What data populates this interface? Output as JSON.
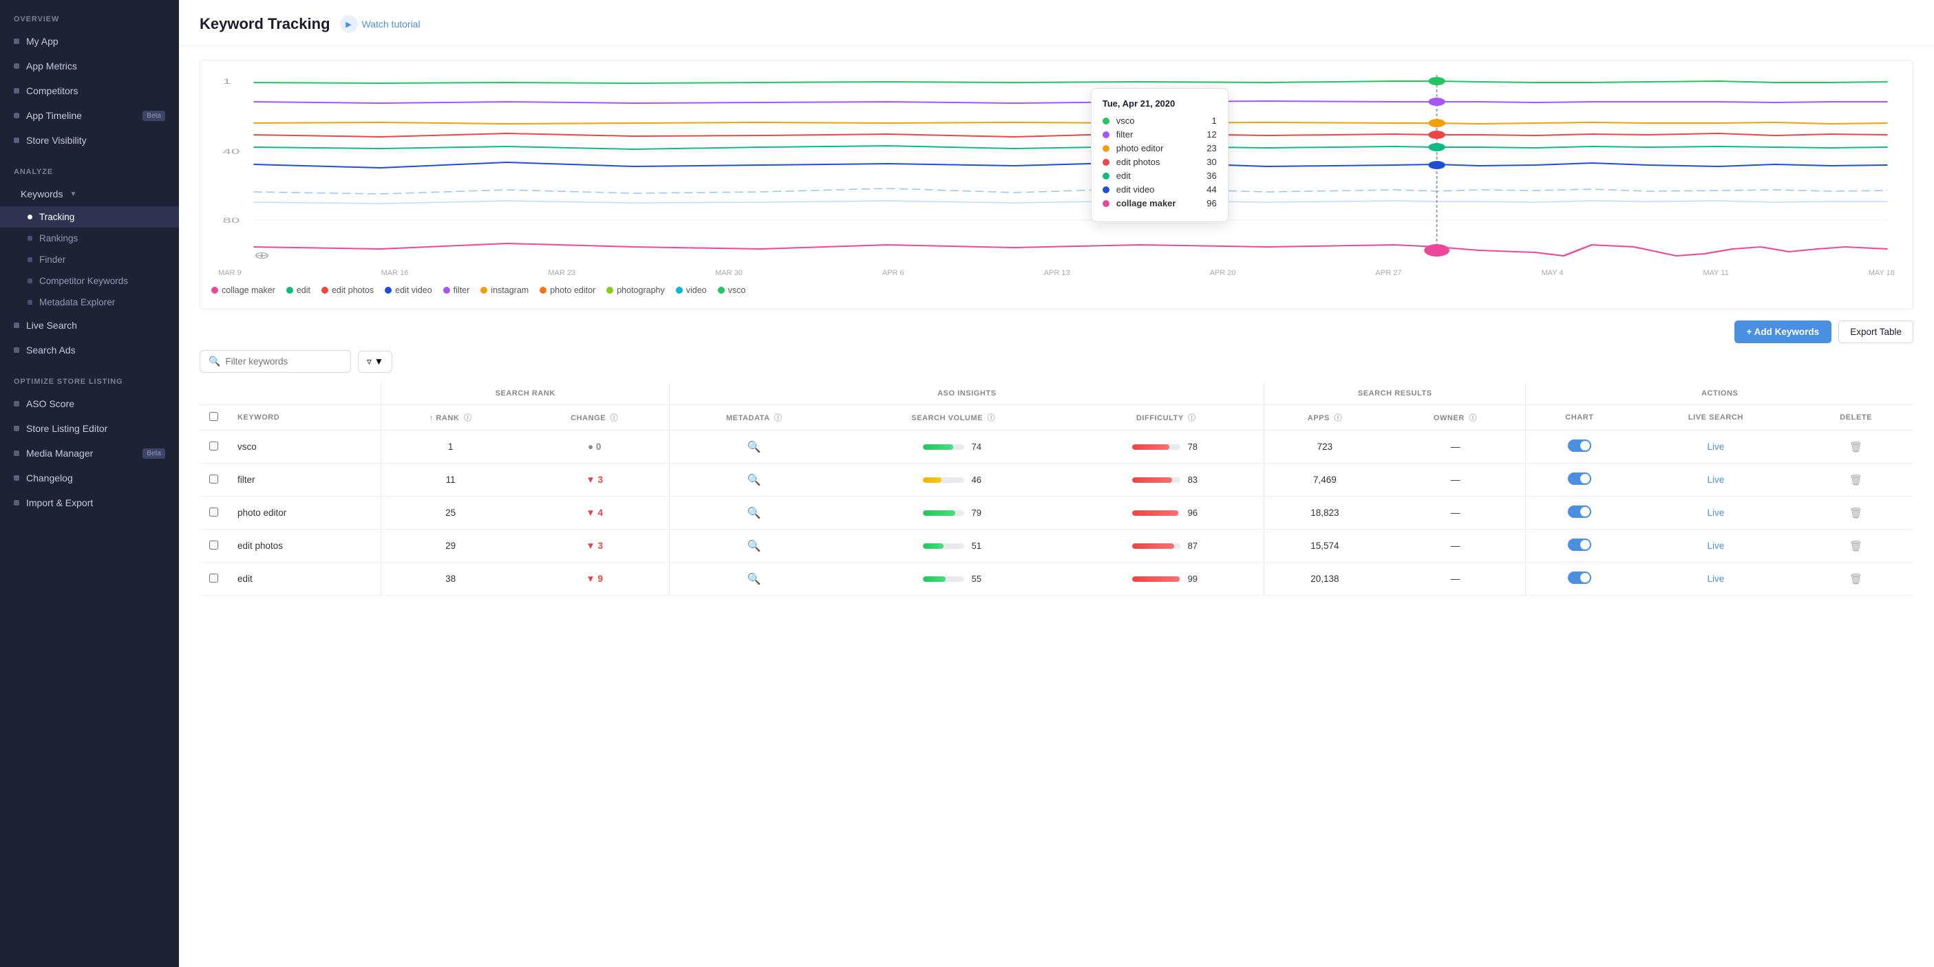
{
  "sidebar": {
    "overview_label": "OVERVIEW",
    "analyze_label": "ANALYZE",
    "optimize_label": "OPTIMIZE STORE LISTING",
    "items_overview": [
      {
        "label": "My App",
        "name": "my-app"
      },
      {
        "label": "App Metrics",
        "name": "app-metrics"
      },
      {
        "label": "Competitors",
        "name": "competitors"
      },
      {
        "label": "App Timeline",
        "name": "app-timeline",
        "badge": "Beta"
      },
      {
        "label": "Store Visibility",
        "name": "store-visibility"
      }
    ],
    "keywords_label": "Keywords",
    "keywords_sub": [
      {
        "label": "Tracking",
        "name": "tracking",
        "active": true
      },
      {
        "label": "Rankings",
        "name": "rankings"
      },
      {
        "label": "Finder",
        "name": "finder"
      },
      {
        "label": "Competitor Keywords",
        "name": "competitor-keywords"
      },
      {
        "label": "Metadata Explorer",
        "name": "metadata-explorer"
      }
    ],
    "items_other_analyze": [
      {
        "label": "Live Search",
        "name": "live-search"
      },
      {
        "label": "Search Ads",
        "name": "search-ads"
      }
    ],
    "items_optimize": [
      {
        "label": "ASO Score",
        "name": "aso-score"
      },
      {
        "label": "Store Listing Editor",
        "name": "store-listing-editor"
      },
      {
        "label": "Media Manager",
        "name": "media-manager",
        "badge": "Beta"
      },
      {
        "label": "Changelog",
        "name": "changelog"
      },
      {
        "label": "Import & Export",
        "name": "import-export"
      }
    ]
  },
  "header": {
    "title": "Keyword Tracking",
    "tutorial_label": "Watch tutorial"
  },
  "tooltip": {
    "date": "Tue, Apr 21, 2020",
    "rows": [
      {
        "color": "#22c55e",
        "keyword": "vsco",
        "rank": "1",
        "bold": false
      },
      {
        "color": "#a855f7",
        "keyword": "filter",
        "rank": "12",
        "bold": false
      },
      {
        "color": "#f59e0b",
        "keyword": "photo editor",
        "rank": "23",
        "bold": false
      },
      {
        "color": "#ef4444",
        "keyword": "edit photos",
        "rank": "30",
        "bold": false
      },
      {
        "color": "#10b981",
        "keyword": "edit",
        "rank": "36",
        "bold": false
      },
      {
        "color": "#1d4ed8",
        "keyword": "edit video",
        "rank": "44",
        "bold": false
      },
      {
        "color": "#ec4899",
        "keyword": "collage maker",
        "rank": "96",
        "bold": true
      }
    ]
  },
  "legend": [
    {
      "label": "collage maker",
      "color": "#ec4899"
    },
    {
      "label": "edit",
      "color": "#10b981"
    },
    {
      "label": "edit photos",
      "color": "#ef4444"
    },
    {
      "label": "edit video",
      "color": "#1d4ed8"
    },
    {
      "label": "filter",
      "color": "#a855f7"
    },
    {
      "label": "instagram",
      "color": "#f59e0b"
    },
    {
      "label": "photo editor",
      "color": "#f97316"
    },
    {
      "label": "photography",
      "color": "#84cc16"
    },
    {
      "label": "video",
      "color": "#06b6d4"
    },
    {
      "label": "vsco",
      "color": "#22c55e"
    }
  ],
  "chart": {
    "y_labels": [
      "1",
      "40",
      "80"
    ],
    "x_labels": [
      "MAR 9",
      "MAR 16",
      "MAR 23",
      "MAR 30",
      "APR 6",
      "APR 13",
      "APR 20",
      "APR 27",
      "MAY 4",
      "MAY 11",
      "MAY 18"
    ]
  },
  "table_controls": {
    "add_keywords_label": "+ Add Keywords",
    "export_label": "Export Table"
  },
  "filter": {
    "search_placeholder": "Filter keywords"
  },
  "columns": {
    "keyword": "KEYWORD",
    "rank": "↑ RANK",
    "change": "CHANGE",
    "metadata": "METADATA",
    "search_volume": "SEARCH VOLUME",
    "difficulty": "DIFFICULTY",
    "apps": "APPS",
    "owner": "OWNER",
    "chart": "CHART",
    "live_search": "LIVE SEARCH",
    "delete": "DELETE",
    "search_rank_group": "SEARCH RANK",
    "aso_insights_group": "ASO INSIGHTS",
    "search_results_group": "SEARCH RESULTS",
    "actions_group": "ACTIONS"
  },
  "rows": [
    {
      "keyword": "vsco",
      "rank": "1",
      "change": "0",
      "change_type": "neutral",
      "search_volume": 74,
      "search_volume_color": "green",
      "difficulty": 78,
      "apps": "723",
      "live_label": "Live"
    },
    {
      "keyword": "filter",
      "rank": "11",
      "change": "3",
      "change_type": "down",
      "search_volume": 46,
      "search_volume_color": "yellow",
      "difficulty": 83,
      "apps": "7,469",
      "live_label": "Live"
    },
    {
      "keyword": "photo editor",
      "rank": "25",
      "change": "4",
      "change_type": "down",
      "search_volume": 79,
      "search_volume_color": "green",
      "difficulty": 96,
      "apps": "18,823",
      "live_label": "Live"
    },
    {
      "keyword": "edit photos",
      "rank": "29",
      "change": "3",
      "change_type": "down",
      "search_volume": 51,
      "search_volume_color": "green",
      "difficulty": 87,
      "apps": "15,574",
      "live_label": "Live"
    },
    {
      "keyword": "edit",
      "rank": "38",
      "change": "9",
      "change_type": "down",
      "search_volume": 55,
      "search_volume_color": "green",
      "difficulty": 99,
      "apps": "20,138",
      "live_label": "Live"
    }
  ]
}
